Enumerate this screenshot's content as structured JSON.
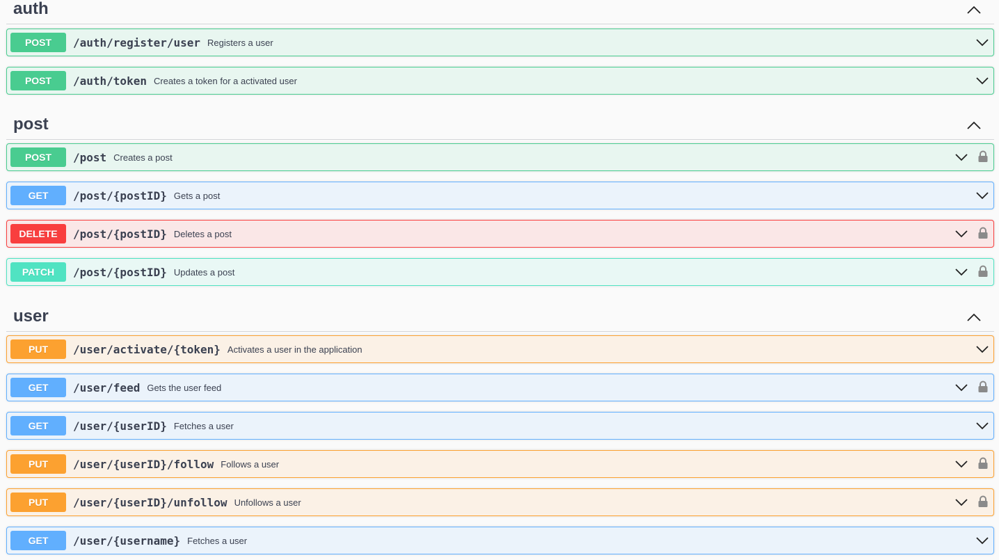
{
  "colors": {
    "post": "#49cc90",
    "get": "#61affe",
    "delete": "#f93e3e",
    "patch": "#50e3c2",
    "put": "#fca130",
    "text": "#3b4151"
  },
  "tags": [
    {
      "name": "auth",
      "operations": [
        {
          "method": "POST",
          "path": "/auth/register/user",
          "summary": "Registers a user",
          "locked": false
        },
        {
          "method": "POST",
          "path": "/auth/token",
          "summary": "Creates a token for a activated user",
          "locked": false
        }
      ]
    },
    {
      "name": "post",
      "operations": [
        {
          "method": "POST",
          "path": "/post",
          "summary": "Creates a post",
          "locked": true
        },
        {
          "method": "GET",
          "path": "/post/{postID}",
          "summary": "Gets a post",
          "locked": false
        },
        {
          "method": "DELETE",
          "path": "/post/{postID}",
          "summary": "Deletes a post",
          "locked": true
        },
        {
          "method": "PATCH",
          "path": "/post/{postID}",
          "summary": "Updates a post",
          "locked": true
        }
      ]
    },
    {
      "name": "user",
      "operations": [
        {
          "method": "PUT",
          "path": "/user/activate/{token}",
          "summary": "Activates a user in the application",
          "locked": false
        },
        {
          "method": "GET",
          "path": "/user/feed",
          "summary": "Gets the user feed",
          "locked": true
        },
        {
          "method": "GET",
          "path": "/user/{userID}",
          "summary": "Fetches a user",
          "locked": false
        },
        {
          "method": "PUT",
          "path": "/user/{userID}/follow",
          "summary": "Follows a user",
          "locked": true
        },
        {
          "method": "PUT",
          "path": "/user/{userID}/unfollow",
          "summary": "Unfollows a user",
          "locked": true
        },
        {
          "method": "GET",
          "path": "/user/{username}",
          "summary": "Fetches a user",
          "locked": false
        }
      ]
    }
  ],
  "icons": {
    "tag_toggle": "chevron-up-icon",
    "op_toggle": "chevron-down-icon",
    "auth": "lock-icon"
  }
}
